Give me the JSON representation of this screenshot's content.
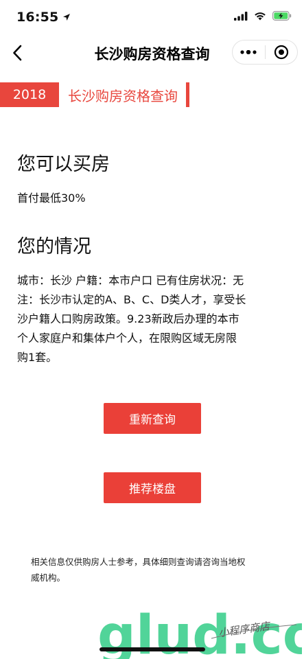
{
  "status_bar": {
    "time": "16:55"
  },
  "nav": {
    "title": "长沙购房资格查询"
  },
  "banner": {
    "year": "2018",
    "title": "长沙购房资格查询"
  },
  "result": {
    "heading": "您可以买房",
    "text": "首付最低30%"
  },
  "situation": {
    "heading": "您的情况",
    "lines": [
      "城市：长沙 户籍：本市户口 已有住房状况：无",
      "注：长沙市认定的A、B、C、D类人才，享受长",
      "沙户籍人口购房政策。9.23新政后办理的本市",
      "个人家庭户和集体户个人，在限购区域无房限",
      "购1套。"
    ]
  },
  "buttons": {
    "requery": "重新查询",
    "recommend": "推荐楼盘"
  },
  "disclaimer": {
    "lines": [
      "相关信息仅供购房人士参考，具体细则查询请咨询当地权",
      "威机构。"
    ]
  },
  "watermark": {
    "brand": "glud.com",
    "tagline": "小程序商店"
  },
  "colors": {
    "accent": "#e8463d",
    "button": "#ea4038",
    "watermark_green": "#3ecf8e",
    "battery_green": "#4cd964"
  },
  "icons": {
    "status_location": "location-arrow-icon",
    "status_signal": "signal-icon",
    "status_wifi": "wifi-icon",
    "status_battery": "battery-charging-icon",
    "nav_back": "chevron-left-icon",
    "capsule_more": "more-dots-icon",
    "capsule_close": "target-circle-icon"
  }
}
